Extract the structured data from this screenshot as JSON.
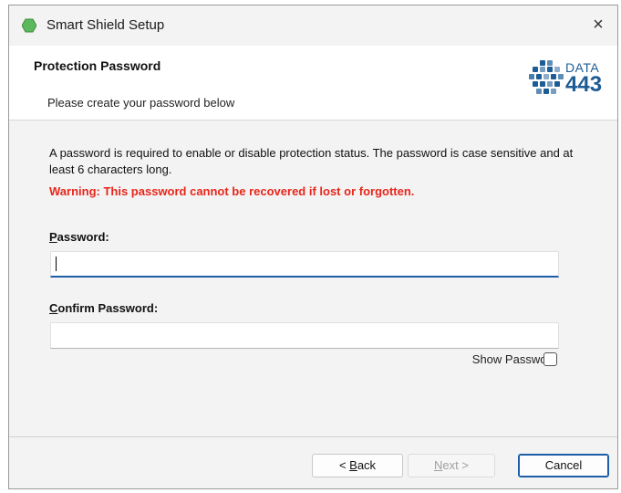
{
  "window": {
    "title": "Smart Shield Setup",
    "close_glyph": "×",
    "app_icon": "green-hexagon-icon",
    "accent_color": "#1e5ea8"
  },
  "header": {
    "title": "Protection Password",
    "subtitle": "Please create your password below",
    "logo": {
      "line1": "DATA",
      "line2": "443",
      "color": "#1d5c95"
    }
  },
  "content": {
    "description": "A password is required to enable or disable protection status. The password is case sensitive and at least 6 characters long.",
    "warning": "Warning: This password cannot be recovered if lost or forgotten.",
    "warning_color": "#e8261b",
    "password_label_mnemonic": "P",
    "password_label_rest": "assword:",
    "password_value": "",
    "confirm_label_mnemonic": "C",
    "confirm_label_rest": "onfirm Password:",
    "confirm_value": "",
    "show_password_label": "Show Password",
    "show_password_checked": false
  },
  "footer": {
    "back_prefix": "< ",
    "back_mnemonic": "B",
    "back_rest": "ack",
    "next_prefix": "",
    "next_mnemonic": "N",
    "next_rest": "ext >",
    "cancel_label": "Cancel"
  }
}
